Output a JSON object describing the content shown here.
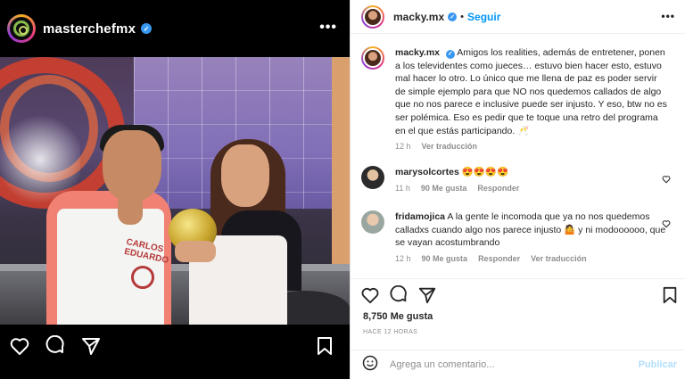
{
  "left": {
    "username": "masterchefmx",
    "apron_text": "CARLOS EDUARDO"
  },
  "post": {
    "author": "macky.mx",
    "follow_label": "Seguir",
    "separator": "•",
    "more_label": "•••",
    "caption": "Amigos los realities, además de entretener, ponen a los televidentes como jueces… estuvo bien hacer esto, estuvo mal hacer lo otro. Lo único que me llena de paz es poder servir de simple ejemplo para que NO nos quedemos callados de algo que no nos parece e inclusive puede ser injusto. Y eso, btw no es ser polémica. Eso es pedir que te toque una retro del programa en el que estás participando. 🥂",
    "caption_time": "12 h",
    "translate_label": "Ver traducción",
    "likes": "8,750 Me gusta",
    "time_ago": "HACE 12 HORAS"
  },
  "comments": [
    {
      "user": "marysolcortes",
      "text": "😍😍😍😍",
      "time": "11 h",
      "likes": "90 Me gusta",
      "reply": "Responder",
      "translate": ""
    },
    {
      "user": "fridamojica",
      "text": "A la gente le incomoda que ya no nos quedemos calladxs cuando algo nos parece injusto 🤷 y ni modoooooo, que se vayan acostumbrando",
      "time": "12 h",
      "likes": "90 Me gusta",
      "reply": "Responder",
      "translate": "Ver traducción"
    }
  ],
  "composer": {
    "placeholder": "Agrega un comentario...",
    "publish_label": "Publicar"
  },
  "colors": {
    "link_blue": "#0095f6",
    "verified_blue": "#3897f0",
    "muted_text": "#8e8e8e"
  },
  "icons": [
    "heart-icon",
    "comment-icon",
    "share-icon",
    "bookmark-icon",
    "emoji-icon",
    "verified-icon",
    "more-icon"
  ]
}
